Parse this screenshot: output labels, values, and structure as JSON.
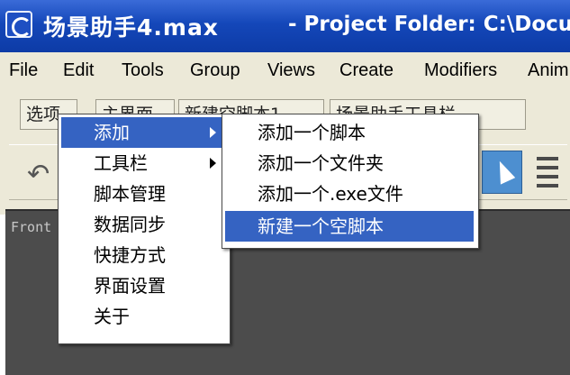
{
  "window": {
    "title": "场景助手4.max",
    "subtitle": "- Project Folder: C:\\Docu"
  },
  "menubar": {
    "items": [
      {
        "label": "File"
      },
      {
        "label": "Edit"
      },
      {
        "label": "Tools"
      },
      {
        "label": "Group"
      },
      {
        "label": "Views"
      },
      {
        "label": "Create"
      },
      {
        "label": "Modifiers"
      },
      {
        "label": "Anim"
      }
    ]
  },
  "tabs": [
    {
      "label": "选项"
    },
    {
      "label": "主界面"
    },
    {
      "label": "新建空脚本1"
    },
    {
      "label": "场景助手工具栏"
    }
  ],
  "viewport": {
    "label": "Front"
  },
  "context_menu": {
    "items": [
      {
        "label": "添加",
        "has_submenu": true,
        "highlighted": true
      },
      {
        "label": "工具栏",
        "has_submenu": true,
        "highlighted": false
      },
      {
        "label": "脚本管理"
      },
      {
        "label": "数据同步"
      },
      {
        "label": "快捷方式"
      },
      {
        "label": "界面设置"
      },
      {
        "label": "关于"
      }
    ]
  },
  "submenu": {
    "items": [
      {
        "label": "添加一个脚本"
      },
      {
        "label": "添加一个文件夹"
      },
      {
        "label": "添加一个.exe文件"
      },
      {
        "label": "新建一个空脚本",
        "highlighted": true
      }
    ]
  },
  "colors": {
    "titlebar": "#1447b9",
    "highlight": "#3563c2",
    "menubar": "#ece9d8",
    "viewport": "#4c4c4c"
  }
}
